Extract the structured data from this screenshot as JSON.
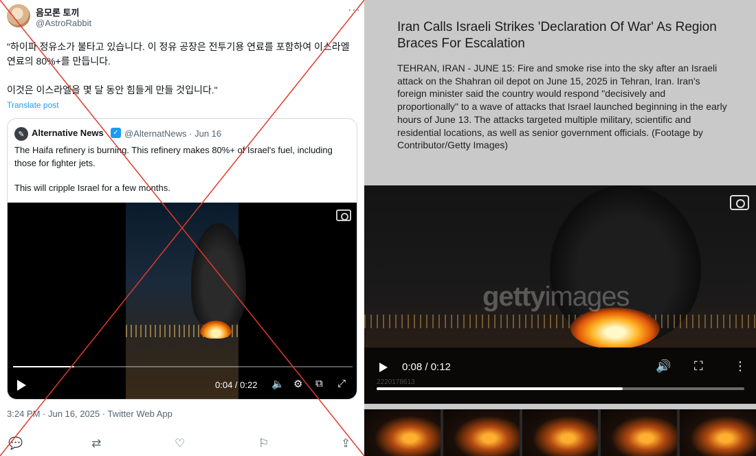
{
  "tweet": {
    "author_name": "음모론 토끼",
    "author_handle": "@AstroRabbit",
    "more_icon": "more-icon",
    "text_paragraphs": [
      "\"하이파 정유소가 불타고 있습니다. 이 정유 공장은 전투기용 연료를 포함하여 이스라엘 연료의 80%+를 만듭니다.",
      "이것은 이스라엘을 몇 달 동안 힘들게 만들 것입니다.\""
    ],
    "translate_label": "Translate post",
    "timestamp": "3:24 PM · Jun 16, 2025 · Twitter Web App"
  },
  "quoted_tweet": {
    "author_name": "Alternative News",
    "author_handle": "@AlternatNews",
    "date": "Jun 16",
    "text_paragraphs": [
      "The Haifa refinery is burning. This refinery makes 80%+ of Israel's fuel, including those for fighter jets.",
      "This will cripple Israel for a few months."
    ],
    "video": {
      "time": "0:04 / 0:22",
      "progress": 0.18
    }
  },
  "news": {
    "headline": "Iran Calls Israeli Strikes 'Declaration Of War' As Region Braces For Escalation",
    "caption": "TEHRAN, IRAN - JUNE 15: Fire and smoke rise into the sky after an Israeli attack on the Shahran oil depot on June 15, 2025 in Tehran, Iran. Iran's foreign minister said the country would respond \"decisively and proportionally\" to a wave of attacks that Israel launched beginning in the early hours of June 13. The attacks targeted multiple military, scientific and residential locations, as well as senior government officials. (Footage by Contributor/Getty Images)",
    "video": {
      "watermark_a": "getty",
      "watermark_b": "images",
      "image_id": "2220178613",
      "time": "0:08 / 0:12",
      "progress": 0.67
    }
  },
  "overlay": {
    "cross_color": "#e0392b"
  }
}
